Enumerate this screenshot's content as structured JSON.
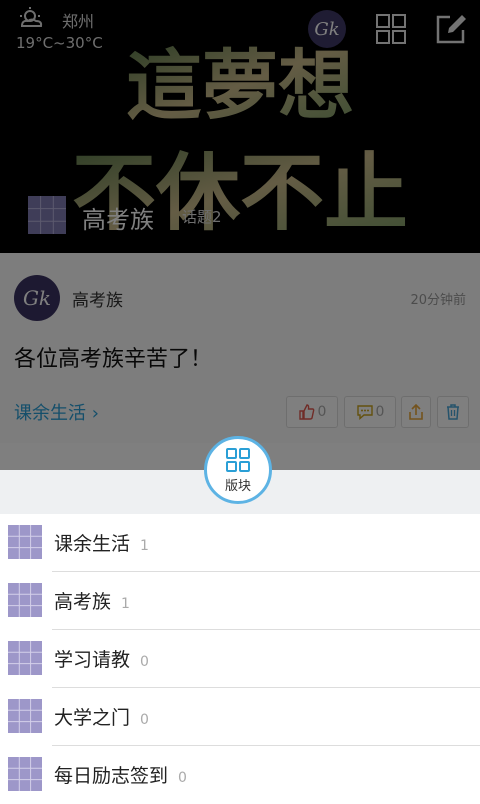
{
  "weather": {
    "city": "郑州",
    "temp": "19°C~30°C"
  },
  "top": {
    "avatar_text": "Gk"
  },
  "hero": {
    "headline": [
      "這夢想",
      "不休不止"
    ],
    "title": "高考族",
    "subtitle": "话题2"
  },
  "post": {
    "avatar_text": "Gk",
    "author": "高考族",
    "time": "20分钟前",
    "text": "各位高考族辛苦了！",
    "board": "课余生活 ›",
    "likes": "0",
    "comments": "0"
  },
  "panel": {
    "button_label": "版块",
    "items": [
      {
        "name": "课余生活",
        "count": "1"
      },
      {
        "name": "高考族",
        "count": "1"
      },
      {
        "name": "学习请教",
        "count": "0"
      },
      {
        "name": "大学之门",
        "count": "0"
      },
      {
        "name": "每日励志签到",
        "count": "0"
      }
    ]
  },
  "colors": {
    "accent": "#2a9fd6",
    "fab_border": "#5db3e4",
    "like": "#e0584e",
    "comment": "#c8a21a",
    "share": "#e8a63a",
    "delete": "#4aa6d8"
  }
}
